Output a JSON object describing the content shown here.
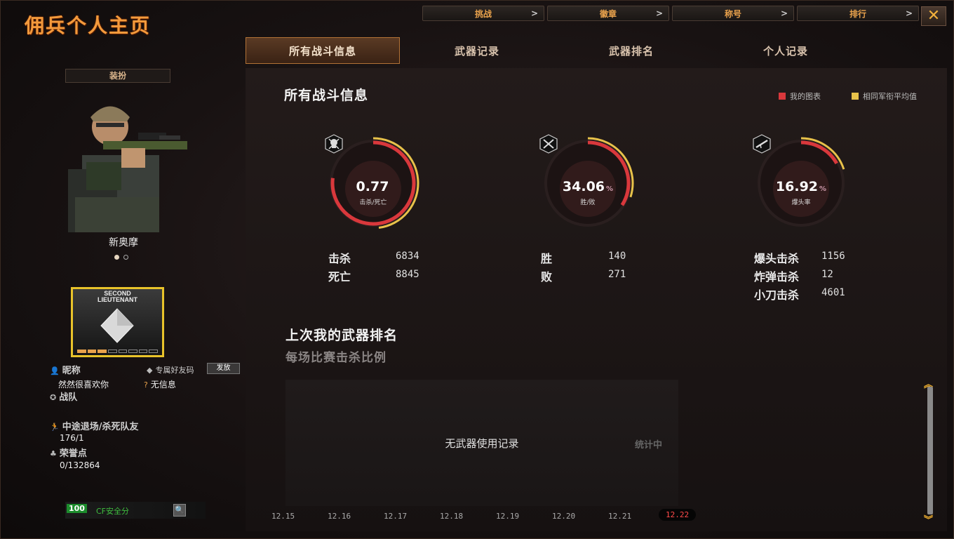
{
  "app": {
    "title": "佣兵个人主页",
    "close_label": "✕"
  },
  "top_menu": [
    {
      "label": "挑战"
    },
    {
      "label": "徽章"
    },
    {
      "label": "称号"
    },
    {
      "label": "排行"
    }
  ],
  "tabs": [
    {
      "label": "所有战斗信息",
      "active": true
    },
    {
      "label": "武器记录",
      "active": false
    },
    {
      "label": "武器排名",
      "active": false
    },
    {
      "label": "个人记录",
      "active": false
    }
  ],
  "left": {
    "outfit_label": "装扮",
    "character_name": "新奥摩",
    "rank_badge_text": "SECOND\nLIEUTENANT",
    "rank_progress": 0.4,
    "nickname_label": "昵称",
    "nickname_value": "然然很喜欢你",
    "friend_code_label": "专属好友码",
    "send_label": "发放",
    "no_info_label": "无信息",
    "team_label": "战队",
    "quit_kill_label": "中途退场/杀死队友",
    "quit_kill_value": "176/1",
    "honor_label": "荣誉点",
    "honor_value": "0/132864",
    "security_score": "100",
    "security_label": "CF安全分"
  },
  "main": {
    "section_title": "所有战斗信息",
    "legend": {
      "mine": "我的图表",
      "avg": "相同军衔平均值",
      "mine_color": "#d9383c",
      "avg_color": "#e8c24a"
    },
    "gauges": [
      {
        "value": "0.77",
        "percent": "",
        "label": "击杀/死亡",
        "icon": "skull-icon",
        "mine": 0.77,
        "avg": 0.48
      },
      {
        "value": "34.06",
        "percent": "%",
        "label": "胜/败",
        "icon": "crossed-swords-icon",
        "mine": 0.3406,
        "avg": 0.3
      },
      {
        "value": "16.92",
        "percent": "%",
        "label": "爆头率",
        "icon": "rifle-icon",
        "mine": 0.1692,
        "avg": 0.2
      }
    ],
    "stats": {
      "kills_label": "击杀",
      "kills": "6834",
      "deaths_label": "死亡",
      "deaths": "8845",
      "wins_label": "胜",
      "wins": "140",
      "losses_label": "败",
      "losses": "271",
      "headshot_label": "爆头击杀",
      "headshot": "1156",
      "bomb_label": "炸弹击杀",
      "bomb": "12",
      "knife_label": "小刀击杀",
      "knife": "4601"
    },
    "weapon_rank_title": "上次我的武器排名",
    "weapon_rank_subtitle": "每场比赛击杀比例",
    "empty_message": "无武器使用记录",
    "stat_pending": "统计中",
    "dates": [
      "12.15",
      "12.16",
      "12.17",
      "12.18",
      "12.19",
      "12.20",
      "12.21",
      "12.22"
    ],
    "selected_date": "12.22"
  }
}
